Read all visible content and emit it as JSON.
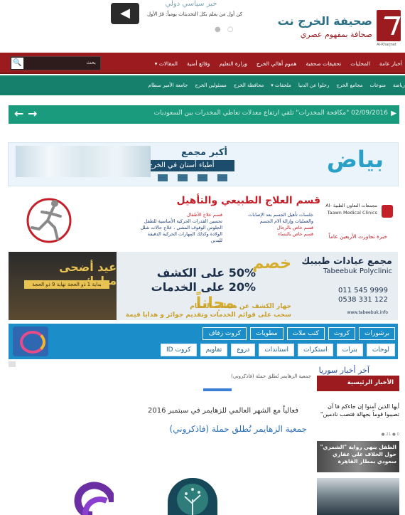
{
  "header": {
    "logo_title": "صحيفة الخرج نت",
    "logo_subtitle": "صحافة بمفهوم عصري",
    "logo_en": "Al-Kharjnet",
    "promo_top": "خبر سياسي دولي",
    "promo_line": "كن أول من يعلم بكل التحديثات يومياً: قرّ الأول",
    "dots": "○ ●",
    "back_icon": "arrow-left-icon"
  },
  "nav_primary": {
    "items": [
      "أخبار عامة",
      "المحليات",
      "تحقيقات صحفية",
      "هموم أهالي الخرج",
      "وزارة التعليم",
      "وقائع أمنية",
      "المقالات ▾"
    ],
    "search_placeholder": "بحث",
    "search_icon": "search-icon"
  },
  "nav_secondary": {
    "items": [
      "رياضة",
      "منوعات",
      "مجامع الخرج",
      "رحلوا عن الدنيا",
      "ملحقات ▾",
      "محافظة الخرج",
      "مسئولين الخرج",
      "جامعة الأمير سطام"
    ]
  },
  "ticker": {
    "text": "02/09/2016 \"مكافحة المخدرات\" تلقي ارتفاع معدلات تعاطي المخدرات بين السعوديات",
    "play_icon": "play-icon",
    "nav_icons": "← →"
  },
  "ads": {
    "dental": {
      "logo": "بياض",
      "title": "أكبر مجمع",
      "subtitle": "أطباء أسنان في الخرج"
    },
    "physio": {
      "title": "قسم العلاج الطبيعي والتأهيل",
      "right_block": "مجمعات التعاون الطبية Al-Taawn Medical Clinics",
      "mid_block": "جلسات تأهيل الجسم بعد الإصابات والعمليات وإزالة آلام الجسم",
      "mid_red_1": "قسم خاص بالرجال",
      "mid_red_2": "قسم خاص بالنساء",
      "left_title": "قسم علاج الأطفال",
      "left_block": "تحسين القدرات الحركية الأساسية للطفل الجلوس الوقوف المشي ، علاج حالات شلل الولادة وكذلك المهارات الحركية الدقيقة لليدين",
      "anniversary": "خبرة تجاوزت الأربعين عاماً"
    },
    "clinic": {
      "name": "مجمع عيادات طبيبك",
      "name_en": "Tabeebuk Polyclinic",
      "phone_1": "011 545 9999",
      "phone_2": "0538 331 122",
      "website": "www.tabeebuk.info",
      "offer_word": "خصم",
      "offer_1": "50% على الكشف",
      "offer_2": "20% على الخدمات",
      "free": "مجاناً",
      "footer_1": "جهاز الكشف عن هشاشة العظام",
      "footer_2": "سحب على قوائم الخدمات وتقديم جوائز و هدايا قيمة",
      "eid_title": "عيد أضحى مبارك",
      "eid_date": "بداية 1 ذو الحجة نهاية 9 ذو الحجة"
    },
    "print": {
      "row1": [
        "برشورات",
        "كروت",
        "كتب ملات",
        "مطويات",
        "كروت زفاف"
      ],
      "row2": [
        "لوحات",
        "بنرات",
        "استكرات",
        "استاندات",
        "دروع",
        "تقاويم",
        "كروت ID"
      ]
    }
  },
  "content": {
    "top_headline": "آخر أخبار سوريا",
    "breadcrumb": "جمعية الزهايمر تُطلق حملة (فاذكروني)",
    "article_sub": "فعالياً مع الشهر العالمي للزهايمر في سبتمبر 2016",
    "article_title": "جمعية الزهايمر تُطلق حملة (فاذكروني)"
  },
  "sidebar": {
    "section_title": "الأخبار الرئيسية",
    "item_1": "أيها الذين آمنوا إن جاءكم فا آن تصيبوا قوماً بجهالة فتصب نادمين\"",
    "item_1_meta": "0 ● 21 ●",
    "thumb_1_text": "الطفل ينهي رواية \"الشمري\" حول الخلاف على عقاري سعودي بمطار القاهرة"
  },
  "colors": {
    "brand_red": "#9b1b1f",
    "brand_green": "#17806d",
    "ticker_green": "#1a9b7d",
    "link_blue": "#2b6fb8"
  }
}
